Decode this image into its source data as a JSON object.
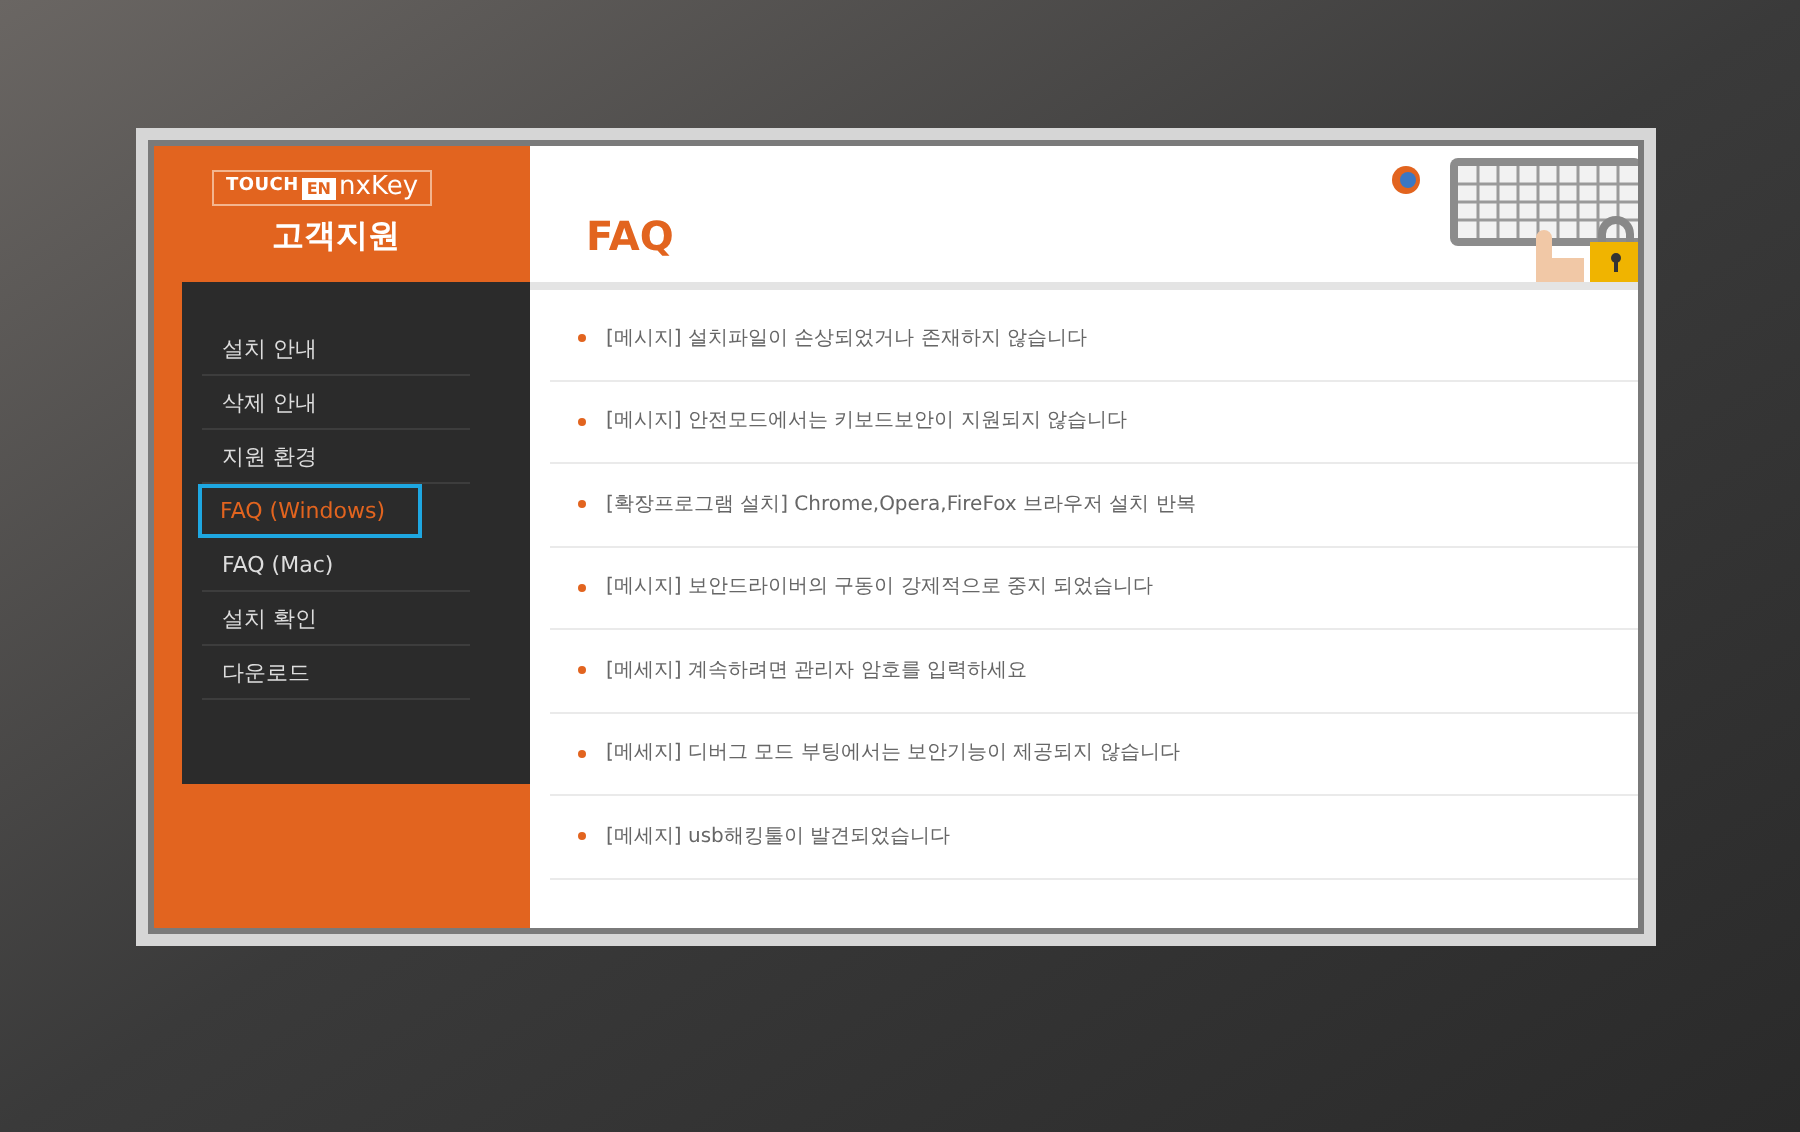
{
  "logo": {
    "parts": [
      "TOUCH",
      "EN",
      "nxKey"
    ]
  },
  "sidebar": {
    "title": "고객지원",
    "items": [
      {
        "label": "설치 안내",
        "selected": false
      },
      {
        "label": "삭제 안내",
        "selected": false
      },
      {
        "label": "지원 환경",
        "selected": false
      },
      {
        "label": "FAQ (Windows)",
        "selected": true
      },
      {
        "label": "FAQ (Mac)",
        "selected": false
      },
      {
        "label": "설치 확인",
        "selected": false
      },
      {
        "label": "다운로드",
        "selected": false
      }
    ]
  },
  "page": {
    "title": "FAQ"
  },
  "faq": [
    "[메시지] 설치파일이 손상되었거나 존재하지 않습니다",
    "[메시지] 안전모드에서는 키보드보안이 지원되지 않습니다",
    "[확장프로그램 설치] Chrome,Opera,FireFox 브라우저 설치 반복",
    "[메시지] 보안드라이버의 구동이 강제적으로 중지 되었습니다",
    "[메세지] 계속하려면 관리자 암호를 입력하세요",
    "[메세지] 디버그 모드 부팅에서는 보안기능이 제공되지 않습니다",
    "[메세지] usb해킹툴이 발견되었습니다"
  ]
}
